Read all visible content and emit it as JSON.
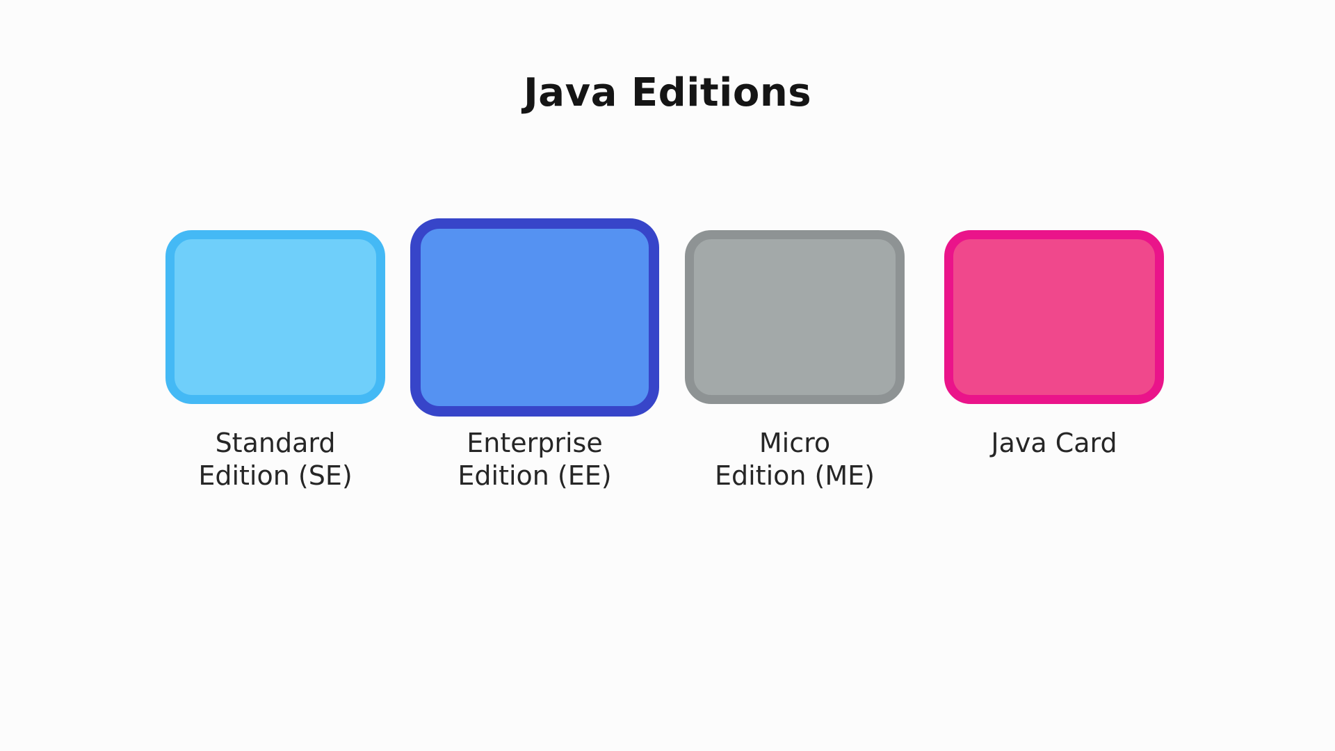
{
  "diagram": {
    "title": "Java Editions",
    "editions": [
      {
        "label": "Standard\nEdition (SE)",
        "fill": "#6fcffa",
        "border": "#44b9f5"
      },
      {
        "label": "Enterprise\nEdition (EE)",
        "fill": "#5592f2",
        "border": "#3745c9"
      },
      {
        "label": "Micro\nEdition (ME)",
        "fill": "#a3a9a9",
        "border": "#8e9394"
      },
      {
        "label": "Java Card",
        "fill": "#f0488c",
        "border": "#ea148a"
      }
    ]
  }
}
